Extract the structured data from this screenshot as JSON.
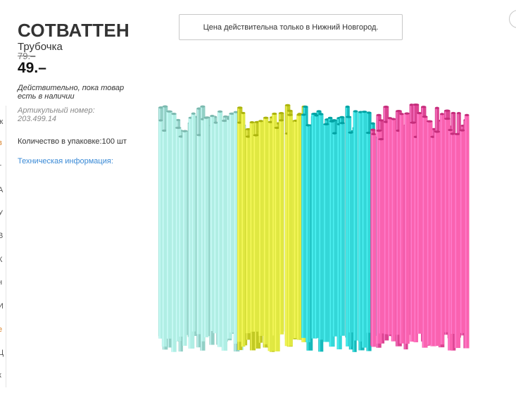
{
  "product": {
    "name": "СОТВАТТЕН",
    "subtitle": "Трубочка",
    "old_price": "79.–",
    "new_price": "49.–",
    "validity_note": "Действительно, пока товар есть в наличии",
    "article_number": "Артикульный номер: 203.499.14",
    "pack_quantity": "Количество в упаковке:100 шт",
    "tech_info_link": "Техническая информация:"
  },
  "notice": {
    "text": "Цена действительна только в Нижний Новгород."
  },
  "left_edge_chars": [
    "ж",
    "в",
    "т",
    "А",
    "У",
    "В",
    "К",
    "н",
    "И",
    "е",
    "Ц",
    "к"
  ],
  "image": {
    "subject": "drinking straws",
    "colors": [
      "#a8e6dc",
      "#d8e03a",
      "#2ccfd0",
      "#f25aa8"
    ]
  }
}
